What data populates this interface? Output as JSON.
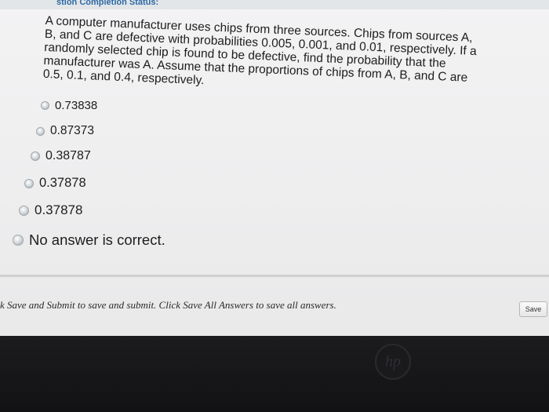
{
  "header": {
    "status_label": "stion Completion Status:"
  },
  "question": {
    "lines": [
      "A computer manufacturer uses chips from three sources. Chips from sources A,",
      "B, and C are defective with probabilities 0.005, 0.001, and 0.01, respectively. If a",
      "randomly selected chip is found to be defective, find the probability that the",
      "manufacturer was A. Assume that the proportions of chips from A, B, and C are",
      "0.5, 0.1, and 0.4, respectively."
    ]
  },
  "options": [
    {
      "label": "0.73838"
    },
    {
      "label": "0.87373"
    },
    {
      "label": "0.38787"
    },
    {
      "label": "0.37878"
    },
    {
      "label": "0.37878"
    },
    {
      "label": "No answer is correct."
    }
  ],
  "footer": {
    "instruction": "k Save and Submit to save and submit. Click Save All Answers to save all answers.",
    "save_label": "Save"
  },
  "icons": {
    "radio": "radio-button-icon",
    "logo": "hp-logo-icon"
  }
}
